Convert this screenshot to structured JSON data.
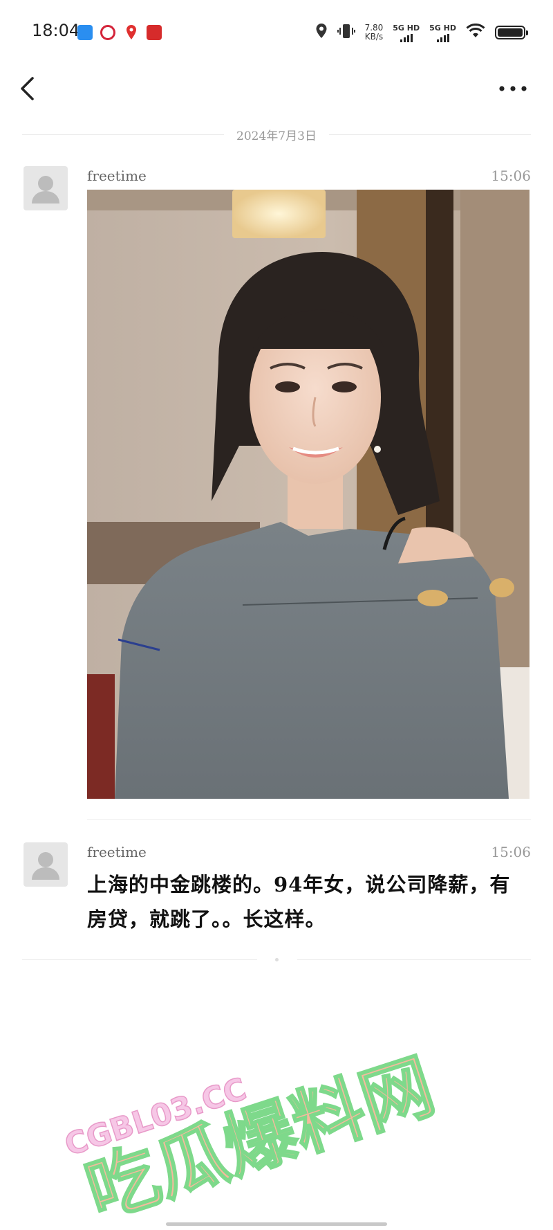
{
  "status_bar": {
    "time": "18:04",
    "net_speed_value": "7.80",
    "net_speed_unit": "KB/s",
    "sim1": "5G HD",
    "sim2": "5G HD",
    "icons": [
      "location-icon",
      "vibrate-icon",
      "wifi-icon",
      "battery-icon"
    ],
    "notification_icons": [
      "blue-app-icon",
      "bank-icon",
      "maps-pin-icon",
      "red-app-icon"
    ]
  },
  "nav": {
    "back_icon": "chevron-left-icon",
    "more_icon": "more-dots-icon"
  },
  "date_separator": "2024年7月3日",
  "messages": [
    {
      "sender": "freetime",
      "time": "15:06",
      "type": "image"
    },
    {
      "sender": "freetime",
      "time": "15:06",
      "type": "text",
      "text": "上海的中金跳楼的。94年女，说公司降薪，有房贷，就跳了。。长这样。"
    }
  ],
  "watermark": {
    "site": "CGBL03.CC",
    "title": "吃瓜爆料网"
  },
  "colors": {
    "background": "#ffffff",
    "separator": "#ececec",
    "watermark_pink": "#f3a9d4",
    "watermark_green": "#7ed98b",
    "watermark_orange": "#f08a5d"
  }
}
